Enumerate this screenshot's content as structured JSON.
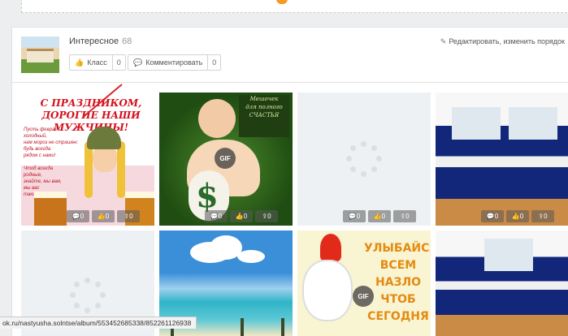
{
  "album": {
    "title": "Интересное",
    "count": "68",
    "edit_link": "Редактировать, изменить порядок",
    "like_label": "Класс",
    "like_count": "0",
    "comment_label": "Комментировать",
    "comment_count": "0"
  },
  "photo1": {
    "headline": "С ПРАЗДНИКОМ,\nДОРОГИЕ НАШИ МУЖЧИНЫ!",
    "verse": "Пусть февраль холодный,\nнам мороз не страшен:\nбудь всегда\nрядом с нами!\n\nЧтоб всегда\nродные,\nзнайте, мы вам,\nмы вас\nтакие!"
  },
  "photo2": {
    "card_text": "Мешочек\nдля полного\nСЧАСТЬЯ"
  },
  "photo7": {
    "text": "УЛЫБАЙСЯ\nВСЕМ НАЗЛО\nЧТОБ\nСЕГОДНЯ"
  },
  "photo_actions": {
    "comments": "0",
    "likes": "0",
    "shares": "0"
  },
  "gif_badge": "GIF",
  "status_url": "ok.ru/nastyusha.solntse/album/553452685338/852261126938",
  "icons": [
    "like-icon",
    "comment-icon",
    "pencil-icon",
    "share-icon"
  ],
  "colors": {
    "accent": "#f59a23",
    "annotation": "#d9252a"
  }
}
